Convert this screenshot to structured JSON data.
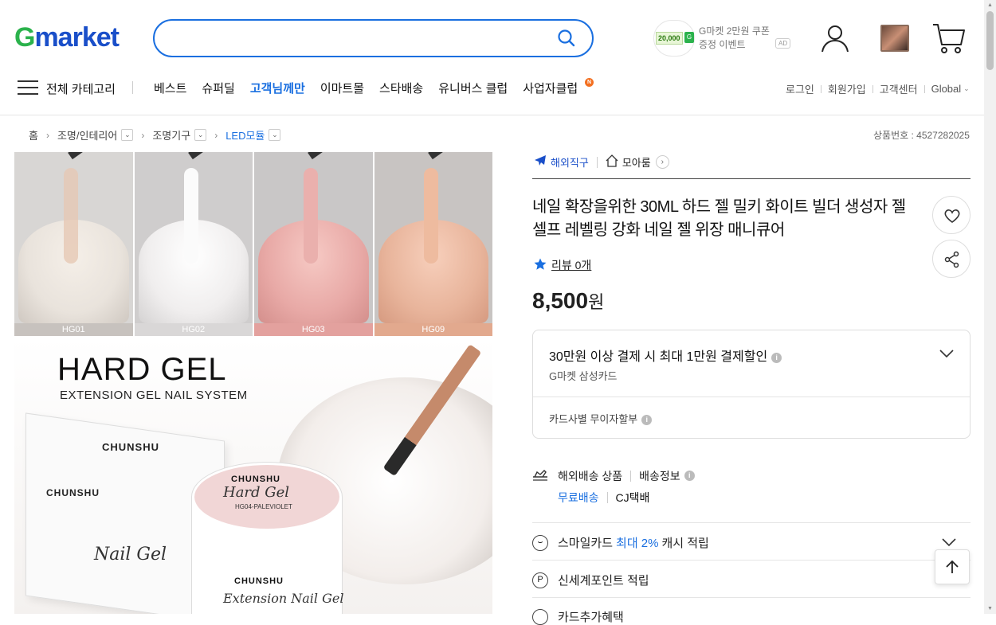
{
  "header": {
    "logo_g": "G",
    "logo_rest": "market",
    "search_placeholder": "",
    "ad": {
      "coupon_amount": "20,000",
      "coupon_mark": "G",
      "text_line1": "G마켓 2만원 쿠폰",
      "text_line2": "증정 이벤트",
      "badge": "AD"
    }
  },
  "nav": {
    "all_categories": "전체 카테고리",
    "links": [
      "베스트",
      "슈퍼딜",
      "고객님께만",
      "이마트몰",
      "스타배송",
      "유니버스 클럽",
      "사업자클럽"
    ],
    "new_badge": "N",
    "util": [
      "로그인",
      "회원가입",
      "고객센터",
      "Global"
    ]
  },
  "breadcrumb": {
    "home": "홈",
    "items": [
      "조명/인테리어",
      "조명기구",
      "LED모듈"
    ],
    "product_no": "상품번호 : 4527282025"
  },
  "images": {
    "swatch_labels": [
      "HG01",
      "HG02",
      "HG03",
      "HG09"
    ],
    "swatch_colors": [
      "#e9e3dc",
      "#f0eeee",
      "#e8a9a6",
      "#e8b49b"
    ],
    "hero_title": "HARD GEL",
    "hero_subtitle": "EXTENSION GEL NAIL SYSTEM",
    "brand": "CHUNSHU",
    "box_script": "Nail Gel",
    "jar_script": "Hard Gel",
    "jar_code": "HG04-PALEVIOLET",
    "jar_script2": "Extension Nail Gel"
  },
  "product": {
    "tag_overseas": "해외직구",
    "tag_store": "모아룸",
    "title": "네일 확장을위한 30ML 하드 젤 밀키 화이트 빌더 생성자 젤 셀프 레벨링 강화 네일 젤 위장 매니큐어",
    "review": "리뷰 0개",
    "price": "8,500",
    "currency": "원"
  },
  "card_benefit": {
    "title": "30만원 이상 결제 시 최대 1만원 결제할인",
    "subtitle": "G마켓 삼성카드",
    "installment": "카드사별 무이자할부"
  },
  "shipping": {
    "label": "해외배송 상품",
    "info": "배송정보",
    "free": "무료배송",
    "carrier": "CJ택배"
  },
  "benefits": {
    "smile_pre": "스마일카드",
    "smile_hl": "최대 2%",
    "smile_post": "캐시 적립",
    "point": "신세계포인트 적립",
    "point_icon": "P",
    "partial": "카드추가혜택"
  },
  "colors": {
    "accent": "#1a6fe0",
    "logo_green": "#2bb24c",
    "logo_blue": "#1a4fc9"
  }
}
